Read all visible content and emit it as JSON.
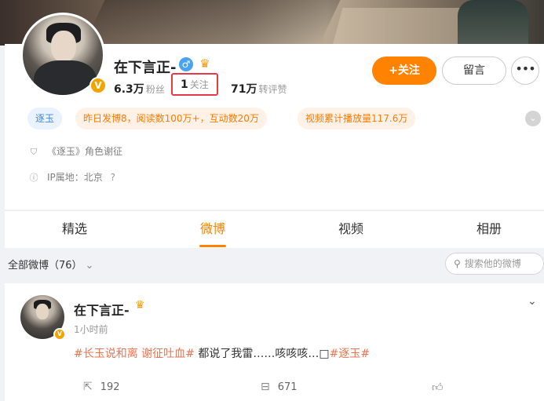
{
  "profile": {
    "name": "在下言正-",
    "stats": {
      "fans_num": "6.3万",
      "fans_label": "粉丝",
      "follow_num": "1",
      "follow_label": "关注",
      "interactions_num": "71万",
      "interactions_label": "转评赞"
    },
    "follow_button": "+关注",
    "message_button": "留言",
    "more_button": "•••",
    "tags": [
      "逐玉",
      "昨日发博8，阅读数100万+，互动数20万",
      "视频累计播放量117.6万"
    ],
    "role": "《逐玉》角色谢征",
    "ip": "IP属地：北京"
  },
  "tabs": [
    "精选",
    "微博",
    "视频",
    "相册"
  ],
  "active_tab": "微博",
  "feed": {
    "filter_label": "全部微博（76）",
    "search_placeholder": "搜索他的微博"
  },
  "post": {
    "author": "在下言正-",
    "time": "1小时前",
    "topic1": "#长玉说和离 谢征吐血#",
    "text": "都说了我雷……咳咳咳…",
    "topic2": "#逐玉#",
    "repost_count": "192",
    "comment_count": "671"
  },
  "colors": {
    "accent": "#ff8200",
    "topic": "#eb7350",
    "highlight_border": "#e8384d"
  }
}
